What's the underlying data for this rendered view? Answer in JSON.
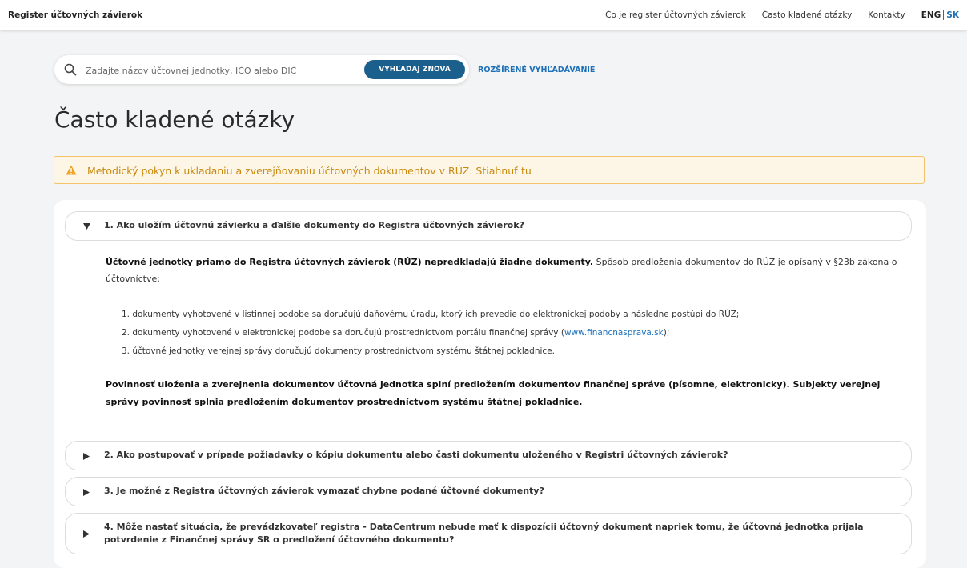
{
  "header": {
    "brand": "Register účtovných závierok",
    "nav": [
      "Čo je register účtovných závierok",
      "Často kladené otázky",
      "Kontakty"
    ],
    "lang_eng": "ENG",
    "lang_sk": "SK"
  },
  "search": {
    "placeholder": "Zadajte názov účtovnej jednotky, IČO alebo DIČ",
    "button_label": "VYHĽADAJ ZNOVA",
    "advanced_label": "ROZŠÍRENÉ VYHĽADÁVANIE"
  },
  "page_title": "Často kladené otázky",
  "alert": {
    "text": "Metodický pokyn k ukladaniu a zverejňovaniu účtovných dokumentov v RÚZ: ",
    "link": "Stiahnuť tu"
  },
  "faq": [
    {
      "question": "1. Ako uložím účtovnú závierku a ďalšie dokumenty do Registra účtovných závierok?",
      "expanded": true,
      "answer": {
        "intro_bold": "Účtovné jednotky priamo do Registra účtovných závierok (RÚZ) nepredkladajú žiadne dokumenty.",
        "intro_rest": " Spôsob predloženia dokumentov do RÚZ je opísaný v §23b zákona o účtovníctve:",
        "items": [
          "1. dokumenty vyhotovené v listinnej podobe sa doručujú daňovému úradu, ktorý ich prevedie do elektronickej podoby a následne postúpi do RÚZ;",
          "2. dokumenty vyhotovené v elektronickej podobe sa doručujú prostredníctvom portálu finančnej správy (",
          "3. účtovné jednotky verejnej správy doručujú dokumenty prostredníctvom systému štátnej pokladnice."
        ],
        "item2_link": "www.financnasprava.sk",
        "item2_tail": ");",
        "footer_bold": "Povinnosť uloženia a zverejnenia dokumentov účtovná jednotka splní predložením dokumentov finančnej správe (písomne, elektronicky). Subjekty verejnej správy povinnosť splnia predložením dokumentov prostredníctvom systému štátnej pokladnice."
      }
    },
    {
      "question": "2. Ako postupovať v prípade požiadavky o kópiu dokumentu alebo časti dokumentu uloženého v Registri účtovných závierok?",
      "expanded": false
    },
    {
      "question": "3. Je možné z Registra účtovných závierok vymazať chybne podané účtovné dokumenty?",
      "expanded": false
    },
    {
      "question": "4. Môže nastať situácia, že prevádzkovateľ registra - DataCentrum nebude mať k dispozícii účtovný dokument napriek tomu, že účtovná jednotka prijala potvrdenie z Finančnej správy SR o predložení účtovného dokumentu?",
      "expanded": false
    }
  ],
  "colors": {
    "accent": "#1b5f8c",
    "link": "#1d70b8",
    "warning_text": "#c88a10",
    "warning_border": "#f2c36a",
    "warning_bg": "#fdf6e7"
  },
  "icons": [
    "search-icon",
    "warning-icon",
    "caret-down-icon",
    "caret-right-icon"
  ]
}
